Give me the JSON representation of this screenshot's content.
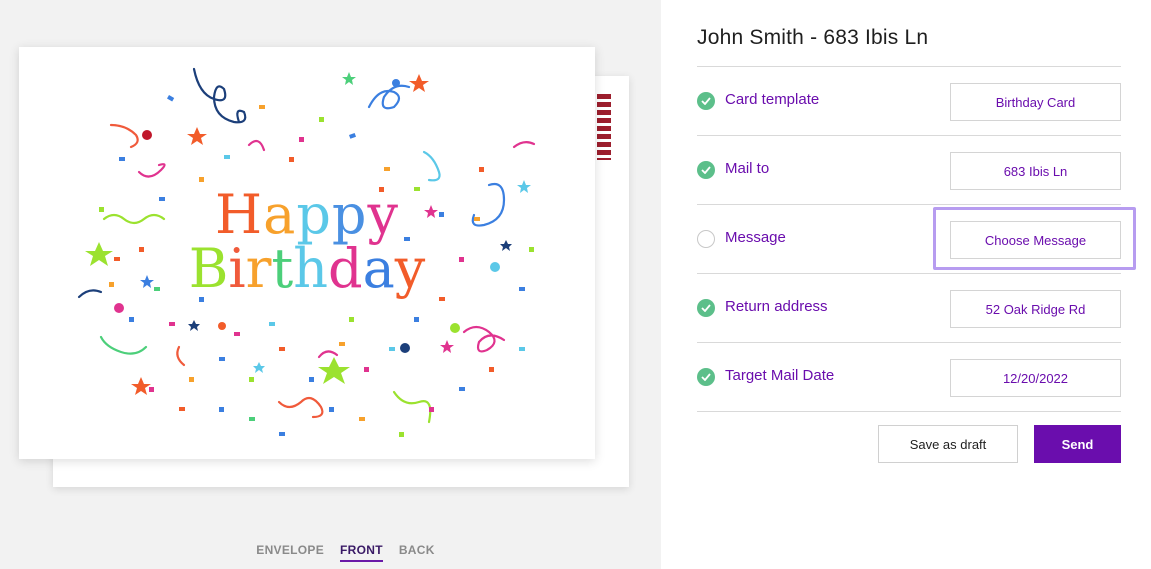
{
  "header": {
    "title": "John Smith - 683 Ibis Ln"
  },
  "card": {
    "greeting_line1": [
      "H",
      "a",
      "p",
      "p",
      "y"
    ],
    "greeting_line2": [
      "B",
      "i",
      "r",
      "t",
      "h",
      "d",
      "a",
      "y"
    ],
    "line1_colors": [
      "#f25c2a",
      "#f7a12c",
      "#5bc8e8",
      "#4a90e2",
      "#e0338f"
    ],
    "line2_colors": [
      "#9be22f",
      "#f05a3b",
      "#f7a12c",
      "#4ccf7a",
      "#5bc8e8",
      "#e0338f",
      "#3b7fe0",
      "#f25c2a"
    ]
  },
  "view_tabs": [
    {
      "label": "ENVELOPE",
      "active": false
    },
    {
      "label": "FRONT",
      "active": true
    },
    {
      "label": "BACK",
      "active": false
    }
  ],
  "rows": [
    {
      "label": "Card template",
      "value": "Birthday Card",
      "complete": true
    },
    {
      "label": "Mail to",
      "value": "683 Ibis Ln",
      "complete": true
    },
    {
      "label": "Message",
      "value": "Choose Message",
      "complete": false
    },
    {
      "label": "Return address",
      "value": "52 Oak Ridge Rd",
      "complete": true
    },
    {
      "label": "Target Mail Date",
      "value": "12/20/2022",
      "complete": true
    }
  ],
  "actions": {
    "draft_label": "Save as draft",
    "send_label": "Send"
  },
  "colors": {
    "accent": "#6a0dad",
    "check": "#5cbf8a",
    "highlight": "#b79cf0"
  }
}
